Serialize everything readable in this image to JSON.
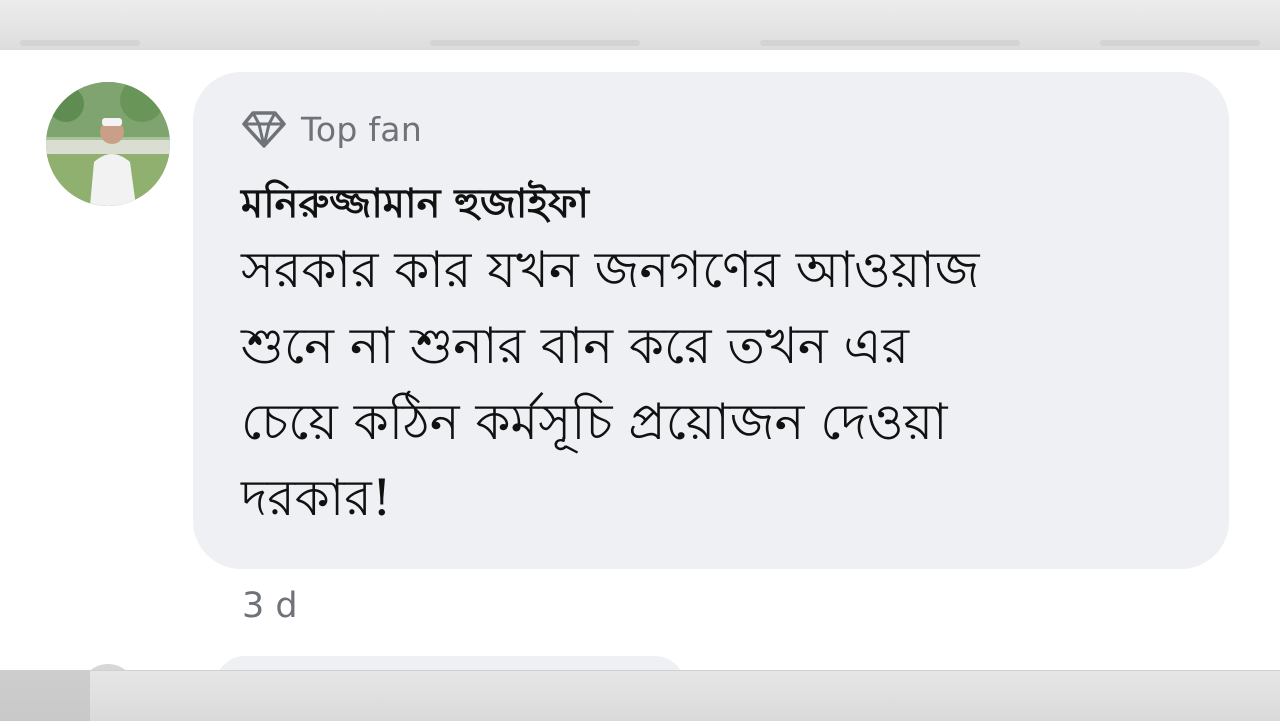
{
  "comment": {
    "badge": {
      "icon": "diamond-icon",
      "label": "Top fan"
    },
    "author": "মনিরুজ্জামান হুজাইফা",
    "text": "সরকার কার যখন জনগণের আওয়াজ\nশুনে না শুনার বান করে তখন এর\nচেয়ে কঠিন কর্মসূচি প্রয়োজন দেওয়া\nদরকার!",
    "timestamp": "3 d",
    "avatar": "avatar-photo"
  },
  "colors": {
    "bubble": "#eff0f4",
    "muted_text": "#6f7279",
    "main_text": "#111111"
  }
}
